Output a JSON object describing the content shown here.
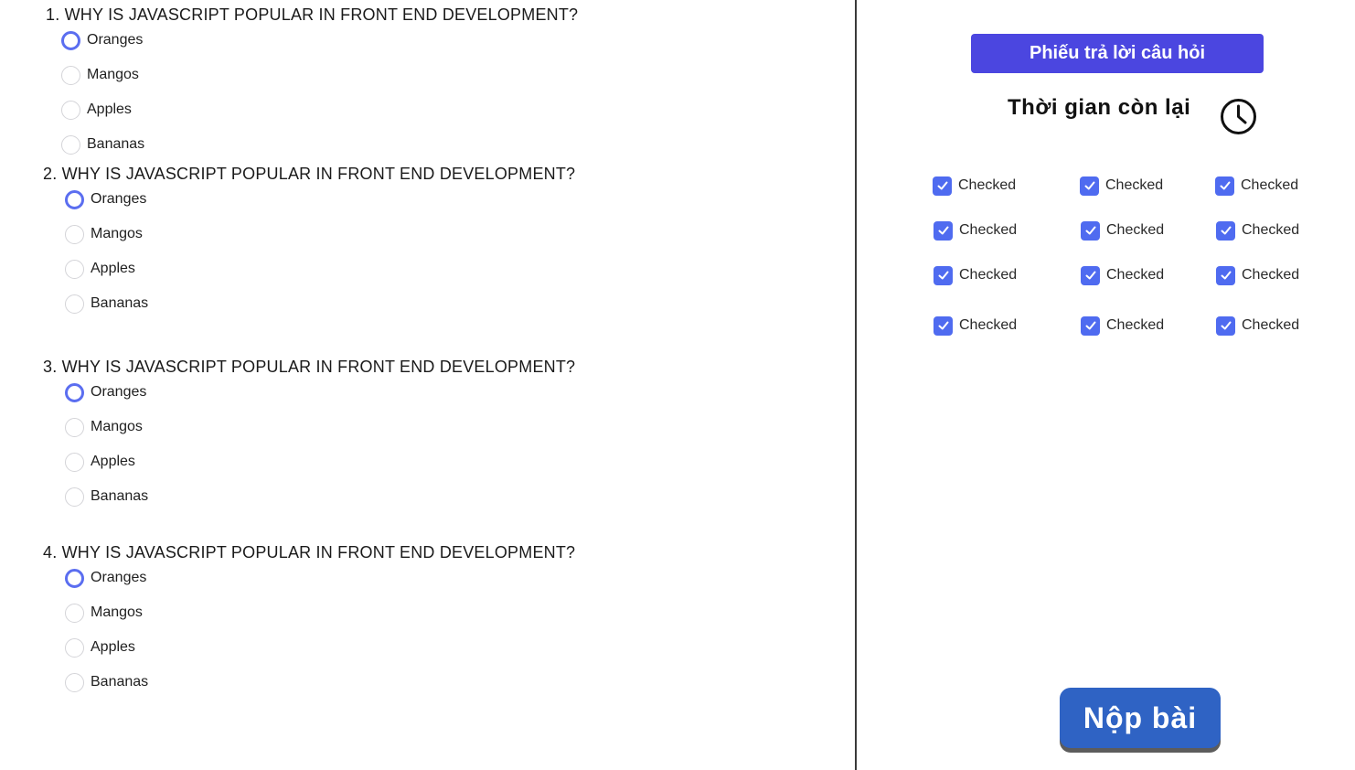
{
  "questions": [
    {
      "title": "1. WHY IS JAVASCRIPT POPULAR IN FRONT END DEVELOPMENT?",
      "options": [
        "Oranges",
        "Mangos",
        "Apples",
        "Bananas"
      ],
      "selected": 0
    },
    {
      "title": "2. WHY IS JAVASCRIPT POPULAR IN FRONT END DEVELOPMENT?",
      "options": [
        "Oranges",
        "Mangos",
        "Apples",
        "Bananas"
      ],
      "selected": 0
    },
    {
      "title": "3. WHY IS JAVASCRIPT POPULAR IN FRONT END DEVELOPMENT?",
      "options": [
        "Oranges",
        "Mangos",
        "Apples",
        "Bananas"
      ],
      "selected": 0
    },
    {
      "title": "4. WHY IS JAVASCRIPT POPULAR IN FRONT END DEVELOPMENT?",
      "options": [
        "Oranges",
        "Mangos",
        "Apples",
        "Bananas"
      ],
      "selected": 0
    }
  ],
  "sidebar": {
    "answer_sheet_label": "Phiếu trả lời câu hỏi",
    "timer_label": "Thời gian còn lại",
    "checkboxes": [
      [
        "Checked",
        "Checked",
        "Checked"
      ],
      [
        "Checked",
        "Checked",
        "Checked"
      ],
      [
        "Checked",
        "Checked",
        "Checked"
      ],
      [
        "Checked",
        "Checked",
        "Checked"
      ]
    ],
    "submit_label": "Nộp bài"
  },
  "colors": {
    "accent": "#4b46e0",
    "radio_selected": "#5b6ef0",
    "checkbox": "#4f6bf0",
    "submit": "#2f63c4"
  },
  "icons": {
    "clock": "clock-icon",
    "check": "check-icon"
  }
}
